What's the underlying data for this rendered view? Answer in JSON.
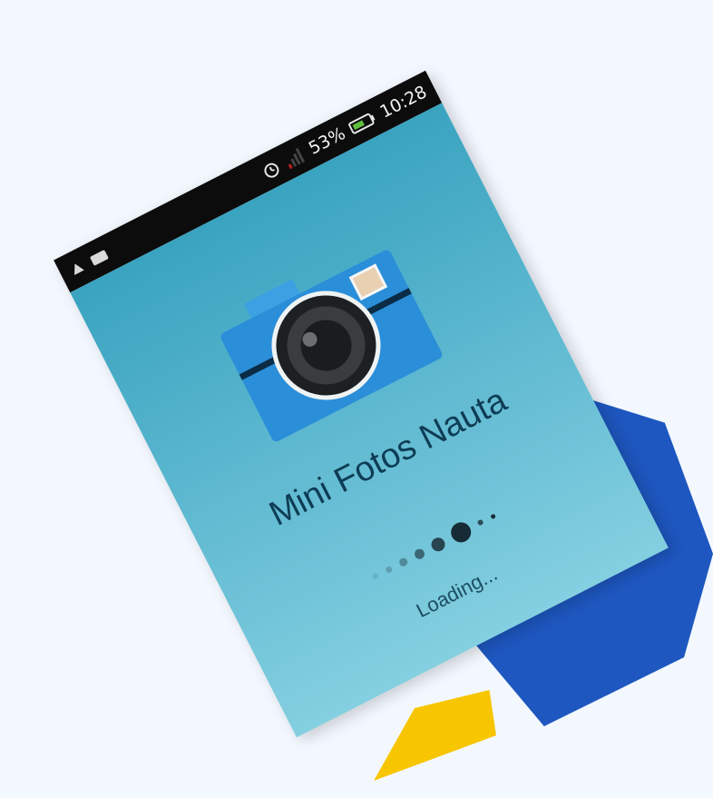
{
  "status_bar": {
    "left_icons": [
      "notification-icon",
      "message-icon"
    ],
    "alarm_icon": "alarm-clock-icon",
    "signal_icon": "signal-bars-icon",
    "battery_percent": "53%",
    "battery_icon": "battery-icon",
    "time": "10:28"
  },
  "app": {
    "title": "Mini Fotos Nauta",
    "loading_text": "Loading...",
    "logo_icon": "camera-icon"
  },
  "colors": {
    "status_bar": "#0c0c0c",
    "screen_top": "#3aa3c0",
    "screen_bottom": "#84cfe0",
    "title_text": "#0e3d55",
    "camera_body": "#2b8ed9",
    "deco_blue": "#1e57c0",
    "deco_yellow": "#f7c600"
  }
}
